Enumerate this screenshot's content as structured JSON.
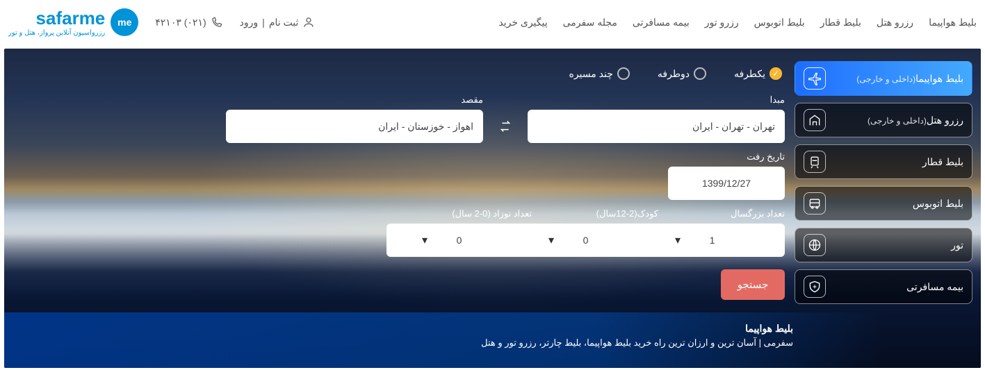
{
  "header": {
    "logo_text": "safarme",
    "logo_sub": "رزرواسیون آنلاین پرواز، هتل و تور",
    "logo_badge": "me",
    "nav": [
      "بلیط هواپیما",
      "رزرو هتل",
      "بلیط قطار",
      "بلیط اتوبوس",
      "رزرو تور",
      "بیمه مسافرتی",
      "مجله سفرمی",
      "پیگیری خرید"
    ],
    "phone": "۴۲۱۰۳ (۰۲۱)",
    "login": "ورود",
    "register": "ثبت نام"
  },
  "tabs": {
    "flight_main": "بلیط هواپیما",
    "flight_sub": "(داخلی و خارجی)",
    "hotel_main": "رزرو هتل",
    "hotel_sub": "(داخلی و خارجی)",
    "train": "بلیط قطار",
    "bus": "بلیط اتوبوس",
    "tour": "تور",
    "insurance": "بیمه مسافرتی"
  },
  "trip": {
    "oneway": "یکطرفه",
    "roundtrip": "دوطرفه",
    "multi": "چند مسیره"
  },
  "form": {
    "origin_label": "مبدا",
    "origin_value": "تهران - تهران - ایران",
    "dest_label": "مقصد",
    "dest_value": "اهواز - خوزستان - ایران",
    "depart_label": "تاریخ رفت",
    "depart_value": "1399/12/27",
    "adult_label": "تعداد بزرگسال",
    "adult_value": "1",
    "child_label": "کودک(2-12سال)",
    "child_value": "0",
    "infant_label": "تعداد نوزاد (0-2 سال)",
    "infant_value": "0",
    "search": "جستجو"
  },
  "footer": {
    "title": "بلیط هواپیما",
    "sub": "سفرمی | آسان ترین و ارزان ترین راه خرید بلیط هواپیما، بلیط چارتر، رزرو تور و هتل"
  }
}
